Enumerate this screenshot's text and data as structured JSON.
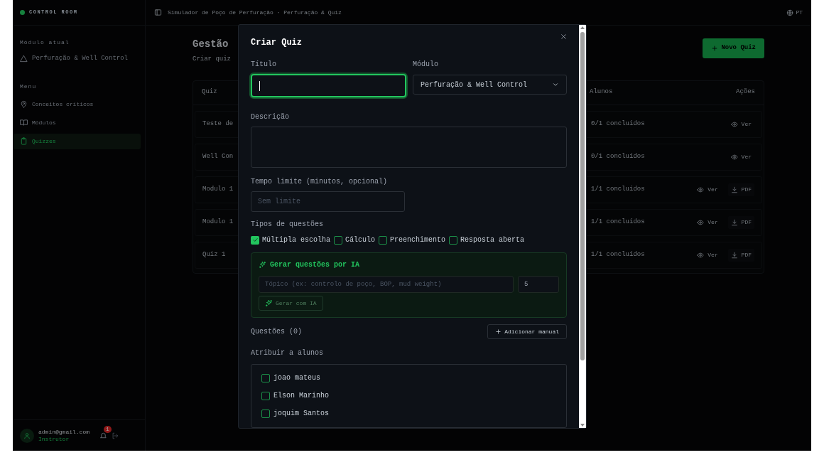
{
  "sidebar": {
    "brand": "CONTROL ROOM",
    "section_label": "Módulo atual",
    "module": "Perfuração & Well Control",
    "nav_label": "Menu",
    "items": [
      {
        "label": "Conceitos críticos",
        "selected": false
      },
      {
        "label": "Módulos",
        "selected": false
      },
      {
        "label": "Quizzes",
        "selected": true
      }
    ],
    "user": {
      "email": "admin@gmail.com",
      "role": "Instrutor"
    },
    "notifications": "1"
  },
  "header": {
    "breadcrumb": "Simulador de Poço de Perfuração · Perfuração & Quiz",
    "language": "PT"
  },
  "page": {
    "title": "Gestão",
    "subtitle": "Criar quiz",
    "new_button": "Novo Quiz",
    "table": {
      "columns": [
        "Quiz",
        "Alunos",
        "Ações"
      ],
      "rows": [
        {
          "quiz": "Teste de",
          "students": "0/1 concluídos",
          "actions": [
            {
              "kind": "view",
              "label": "Ver"
            }
          ]
        },
        {
          "quiz": "Well Con",
          "students": "0/1 concluídos",
          "actions": [
            {
              "kind": "view",
              "label": "Ver"
            }
          ]
        },
        {
          "quiz": "Modulo 1",
          "students": "1/1 concluídos",
          "actions": [
            {
              "kind": "view",
              "label": "Ver"
            },
            {
              "kind": "pdf",
              "label": "PDF"
            }
          ]
        },
        {
          "quiz": "Modulo 1",
          "students": "1/1 concluídos",
          "actions": [
            {
              "kind": "view",
              "label": "Ver"
            },
            {
              "kind": "pdf",
              "label": "PDF"
            }
          ]
        },
        {
          "quiz": "Quiz 1",
          "students": "1/1 concluídos",
          "actions": [
            {
              "kind": "view",
              "label": "Ver"
            },
            {
              "kind": "pdf",
              "label": "PDF"
            }
          ]
        }
      ]
    }
  },
  "modal": {
    "title": "Criar Quiz",
    "title_field": {
      "label": "Título",
      "focused": true
    },
    "module_field": {
      "label": "Módulo",
      "value": "Perfuração & Well Control"
    },
    "description_field": {
      "label": "Descrição"
    },
    "time_field": {
      "label": "Tempo limite (minutos, opcional)",
      "placeholder": "Sem limite"
    },
    "types_label": "Tipos de questões",
    "types": [
      {
        "label": "Múltipla escolha",
        "checked": true
      },
      {
        "label": "Cálculo",
        "checked": false
      },
      {
        "label": "Preenchimento",
        "checked": false
      },
      {
        "label": "Resposta aberta",
        "checked": false
      }
    ],
    "ai": {
      "title": "Gerar questões por IA",
      "topic_placeholder": "Tópico (ex: controlo de poço, BOP, mud weight)",
      "count": "5",
      "button": "Gerar com IA"
    },
    "questions_label": "Questões (0)",
    "add_button": "Adicionar manual",
    "assign_label": "Atribuir a alunos",
    "students": [
      {
        "name": "joao mateus",
        "checked": false
      },
      {
        "name": "Elson Marinho",
        "checked": false
      },
      {
        "name": "joquim Santos",
        "checked": false
      }
    ]
  }
}
